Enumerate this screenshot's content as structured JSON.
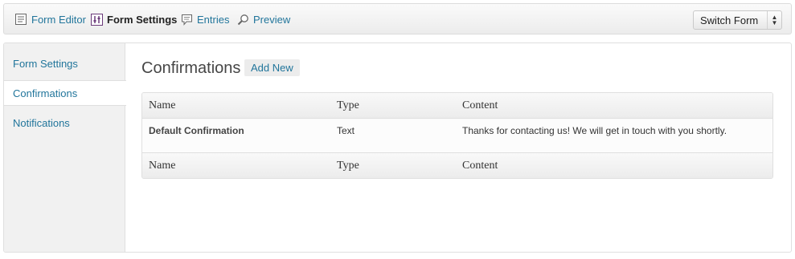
{
  "toolbar": {
    "items": [
      {
        "label": "Form Editor",
        "icon": "form-editor-icon"
      },
      {
        "label": "Form Settings",
        "icon": "form-settings-icon",
        "active": true
      },
      {
        "label": "Entries",
        "icon": "entries-icon"
      },
      {
        "label": "Preview",
        "icon": "preview-icon"
      }
    ],
    "switch_form": "Switch Form"
  },
  "sidebar": {
    "items": [
      {
        "label": "Form Settings"
      },
      {
        "label": "Confirmations",
        "active": true
      },
      {
        "label": "Notifications"
      }
    ]
  },
  "main": {
    "title": "Confirmations",
    "add_new": "Add New",
    "table": {
      "columns": [
        "Name",
        "Type",
        "Content"
      ],
      "rows": [
        {
          "name": "Default Confirmation",
          "type": "Text",
          "content": "Thanks for contacting us! We will get in touch with you shortly."
        }
      ]
    }
  },
  "colors": {
    "link": "#21759b",
    "sidebar_bg": "#f1f1f1",
    "border": "#dfdfdf"
  }
}
